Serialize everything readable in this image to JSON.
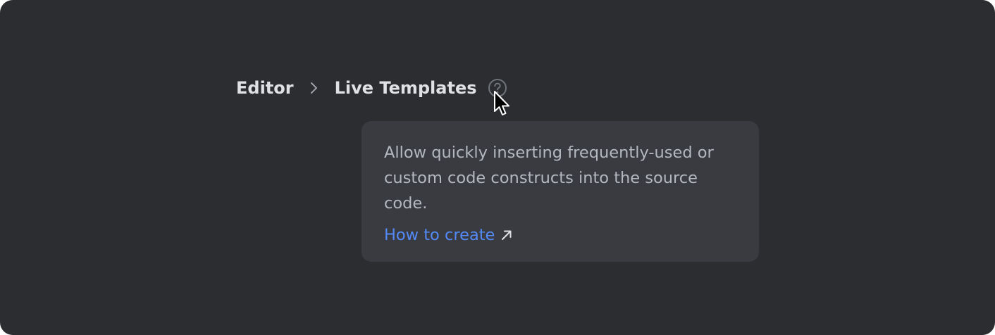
{
  "breadcrumb": {
    "items": [
      {
        "label": "Editor"
      },
      {
        "label": "Live Templates"
      }
    ],
    "separator_icon": "chevron-right-icon",
    "help_icon": "help-circle-icon"
  },
  "tooltip": {
    "description": "Allow quickly inserting frequently-used or custom code constructs into the source code.",
    "link_label": "How to create",
    "link_icon": "external-arrow-icon"
  },
  "colors": {
    "background": "#2b2d30",
    "tooltip_background": "#393b40",
    "breadcrumb_text": "#dfe1e5",
    "tooltip_text": "#b4b8bf",
    "link": "#548af7",
    "icon_muted": "#6f737a"
  }
}
